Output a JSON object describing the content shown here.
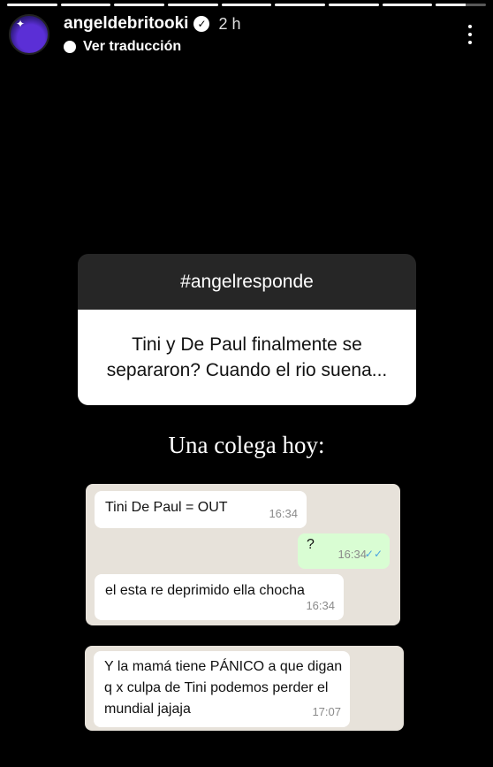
{
  "story": {
    "progress": [
      1,
      1,
      1,
      1,
      1,
      1,
      1,
      1,
      0.6
    ]
  },
  "header": {
    "username": "angeldebritooki",
    "time": "2 h",
    "translate_label": "Ver traducción"
  },
  "question": {
    "title": "#angelresponde",
    "text": "Tini y De Paul finalmente se separaron? Cuando el rio suena..."
  },
  "caption": "Una colega hoy:",
  "chat": {
    "messages": [
      {
        "text": "Tini De Paul = OUT",
        "time": "16:34",
        "direction": "incoming"
      },
      {
        "text": "?",
        "time": "16:34",
        "direction": "outgoing"
      },
      {
        "text": "el esta re deprimido ella chocha",
        "time": "16:34",
        "direction": "incoming"
      },
      {
        "text": "Y la mamá tiene PÁNICO a que digan q x culpa de Tini podemos perder el mundial jajaja",
        "time": "17:07",
        "direction": "incoming"
      }
    ]
  },
  "icons": {
    "verified": "verified-badge-icon",
    "translate": "translate-icon",
    "more": "more-options-icon",
    "read": "double-check-icon"
  },
  "colors": {
    "background": "#000000",
    "question_header": "#262626",
    "chat_background": "#e7e2da",
    "outgoing_bubble": "#d9fdd3",
    "read_ticks": "#4aa3df"
  }
}
